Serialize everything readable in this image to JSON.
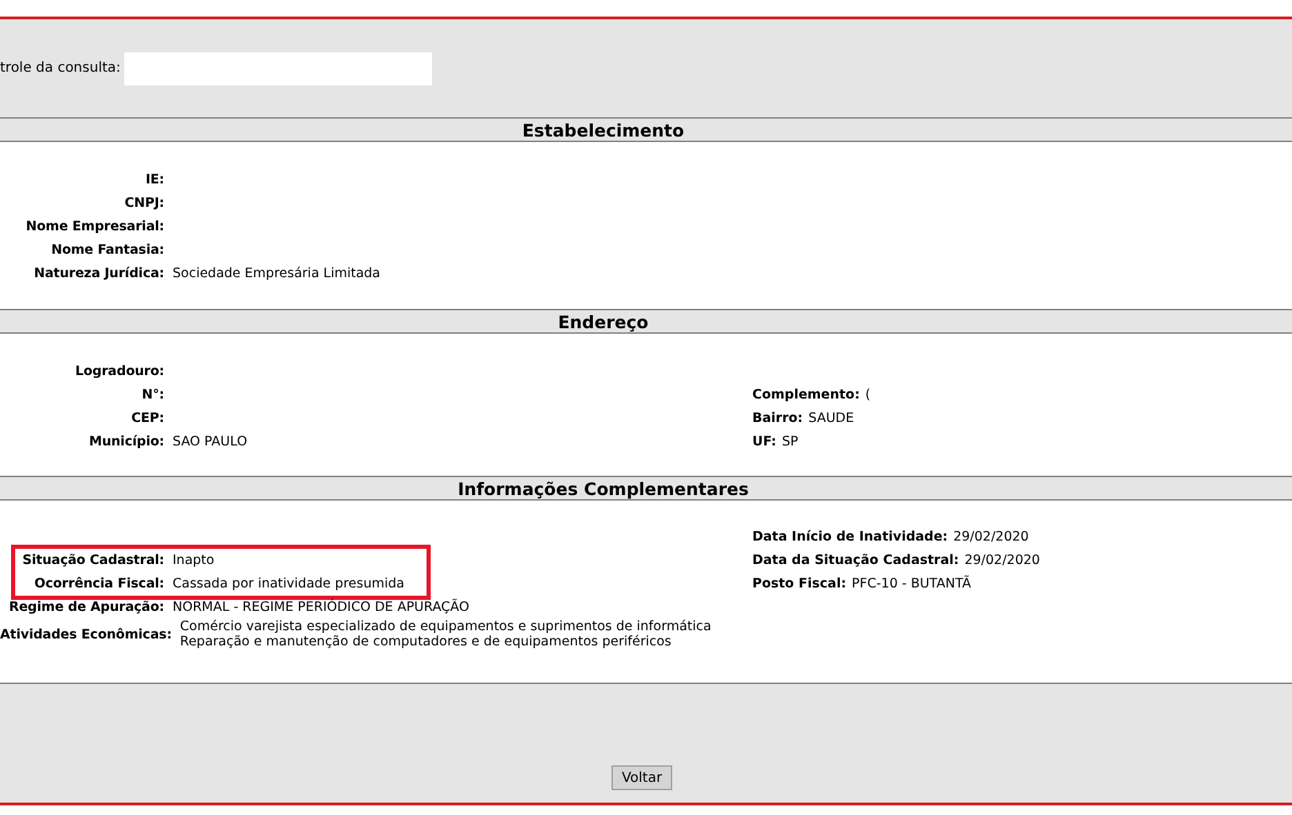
{
  "control": {
    "label": "trole da consulta:"
  },
  "sections": [
    {
      "kind": "establishment",
      "title": "Estabelecimento",
      "left": [
        {
          "label": "IE:",
          "highlighted": false
        },
        {
          "label": "CNPJ:",
          "highlighted": false
        },
        {
          "label": "Nome Empresarial:",
          "highlighted": false
        },
        {
          "label": "Nome Fantasia:",
          "highlighted": false
        },
        {
          "label": "Natureza Jurídica:",
          "values": [
            "Sociedade Empresária Limitada"
          ],
          "highlighted": false
        }
      ]
    },
    {
      "kind": "address",
      "title": "Endereço",
      "left": [
        {
          "label": "Logradouro:",
          "highlighted": false
        },
        {
          "label": "N°:",
          "highlighted": false
        },
        {
          "label": "CEP:",
          "highlighted": false
        },
        {
          "label": "Município:",
          "values": [
            "SAO PAULO"
          ],
          "highlighted": false
        }
      ],
      "right": [
        {
          "label": "Complemento:",
          "value": "("
        },
        {
          "label": "Bairro:",
          "value": "SAUDE"
        },
        {
          "label": "UF:",
          "value": "SP"
        }
      ]
    },
    {
      "kind": "info",
      "title": "Informações Complementares",
      "left": [
        {
          "label": "Situação Cadastral:",
          "values": [
            "Inapto"
          ],
          "highlighted": true
        },
        {
          "label": "Ocorrência Fiscal:",
          "values": [
            "Cassada por inatividade presumida"
          ],
          "highlighted": true
        },
        {
          "label": "Regime de Apuração:",
          "values": [
            "NORMAL - REGIME PERIÓDICO DE APURAÇÃO"
          ],
          "highlighted": false
        },
        {
          "label": "Atividades Econômicas:",
          "values": [
            "Comércio varejista especializado de equipamentos e suprimentos de informática",
            "Reparação e manutenção de computadores e de equipamentos periféricos"
          ],
          "highlighted": false
        }
      ],
      "right": [
        {
          "label": "Data Início de Inatividade:",
          "value": "29/02/2020"
        },
        {
          "label": "Data da Situação Cadastral:",
          "value": "29/02/2020"
        },
        {
          "label": "Posto Fiscal:",
          "value": "PFC-10 - BUTANTÃ"
        }
      ]
    }
  ],
  "back_button": "Voltar"
}
